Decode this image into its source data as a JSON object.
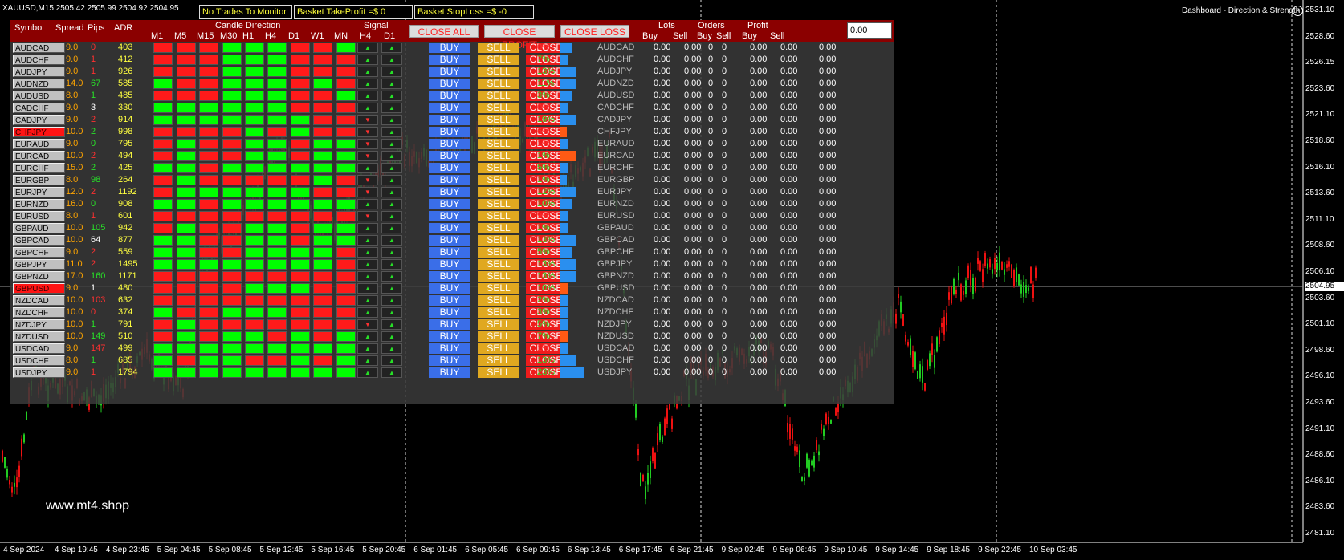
{
  "chart_window": {
    "title": "XAUUSD,M15  2505.42 2505.99 2504.92 2504.95",
    "watermark": "www.mt4.shop",
    "current_price": "2504.95",
    "price_axis": [
      "2531.10",
      "2528.60",
      "2526.15",
      "2523.60",
      "2521.10",
      "2518.60",
      "2516.10",
      "2513.60",
      "2511.10",
      "2508.60",
      "2506.10",
      "2503.60",
      "2501.10",
      "2498.60",
      "2496.10",
      "2493.60",
      "2491.10",
      "2488.60",
      "2486.10",
      "2483.60",
      "2481.10"
    ],
    "time_axis": [
      "4 Sep 2024",
      "4 Sep 19:45",
      "4 Sep 23:45",
      "5 Sep 04:45",
      "5 Sep 08:45",
      "5 Sep 12:45",
      "5 Sep 16:45",
      "5 Sep 20:45",
      "6 Sep 01:45",
      "6 Sep 05:45",
      "6 Sep 09:45",
      "6 Sep 13:45",
      "6 Sep 17:45",
      "6 Sep 21:45",
      "9 Sep 02:45",
      "9 Sep 06:45",
      "9 Sep 10:45",
      "9 Sep 14:45",
      "9 Sep 18:45",
      "9 Sep 22:45",
      "10 Sep 03:45"
    ],
    "close_icon": "close-icon",
    "up_color": "#22cc22",
    "down_color": "#ee1111"
  },
  "info_boxes": {
    "trades": "No Trades To Monitor",
    "tp": "Basket TakeProfit =$ 0",
    "sl": "Basket StopLoss =$ -0"
  },
  "dashboard": {
    "title": "Dashboard - Direction & Strength",
    "headers": {
      "symbol": "Symbol",
      "spread": "Spread",
      "pips": "Pips",
      "adr": "ADR",
      "candle_direction": "Candle Direction",
      "tfs": [
        "M1",
        "M5",
        "M15",
        "M30",
        "H1",
        "H4",
        "D1",
        "W1",
        "MN"
      ],
      "signal": "Signal",
      "signal_tfs": [
        "H4",
        "D1"
      ],
      "close_all": "CLOSE ALL",
      "close_profit": "CLOSE PROFIT",
      "close_loss": "CLOSE LOSS",
      "lots": "Lots",
      "orders": "Orders",
      "profit": "Profit",
      "buy": "Buy",
      "sell": "Sell",
      "amount": "0.00"
    },
    "button_labels": {
      "buy": "BUY",
      "sell": "SELL",
      "close": "CLOSE"
    },
    "zero": "0.00",
    "zero_int": "0",
    "total": "0.00",
    "rows": [
      {
        "symbol": "AUDCAD",
        "spread": "9.0",
        "pips": "0",
        "adr": "403",
        "dir": "RRRGGGRRG",
        "sig": [
          "▲",
          "▲"
        ],
        "pct": "0%",
        "strength": 14,
        "bc": "#2a8fef",
        "hl": false
      },
      {
        "symbol": "AUDCHF",
        "spread": "9.0",
        "pips": "1",
        "adr": "412",
        "dir": "RRRGGGRRR",
        "sig": [
          "▲",
          "▲"
        ],
        "pct": "7%",
        "strength": 10,
        "bc": "#2a8fef",
        "hl": false
      },
      {
        "symbol": "AUDJPY",
        "spread": "9.0",
        "pips": "1",
        "adr": "926",
        "dir": "RRRGGGRRR",
        "sig": [
          "▲",
          "▲"
        ],
        "pct": "13%",
        "strength": 19,
        "bc": "#2a8fef",
        "hl": false
      },
      {
        "symbol": "AUDNZD",
        "spread": "14.0",
        "pips": "67",
        "adr": "585",
        "dir": "GRRGGGRGR",
        "sig": [
          "▲",
          "▲"
        ],
        "pct": "11%",
        "strength": 19,
        "bc": "#2a8fef",
        "hl": false
      },
      {
        "symbol": "AUDUSD",
        "spread": "8.0",
        "pips": "1",
        "adr": "485",
        "dir": "RRRGGGRRG",
        "sig": [
          "▲",
          "▲"
        ],
        "pct": "3%",
        "strength": 14,
        "bc": "#2a8fef",
        "hl": false
      },
      {
        "symbol": "CADCHF",
        "spread": "9.0",
        "pips": "3",
        "adr": "330",
        "dir": "GGGGGGRRR",
        "sig": [
          "▲",
          "▲"
        ],
        "pct": "0%",
        "strength": 10,
        "bc": "#2a8fef",
        "hl": false
      },
      {
        "symbol": "CADJPY",
        "spread": "9.0",
        "pips": "2",
        "adr": "914",
        "dir": "GGGGGGGRR",
        "sig": [
          "▼",
          "▲"
        ],
        "pct": "19%",
        "strength": 19,
        "bc": "#2a8fef",
        "hl": false
      },
      {
        "symbol": "CHFJPY",
        "spread": "10.0",
        "pips": "2",
        "adr": "998",
        "dir": "RRRRGRGRR",
        "sig": [
          "▼",
          "▲"
        ],
        "pct": "6%",
        "strength": 8,
        "bc": "#ff5a14",
        "hl": true
      },
      {
        "symbol": "EURAUD",
        "spread": "9.0",
        "pips": "0",
        "adr": "795",
        "dir": "RGRRGGRGG",
        "sig": [
          "▼",
          "▲"
        ],
        "pct": "1%",
        "strength": 10,
        "bc": "#2a8fef",
        "hl": false
      },
      {
        "symbol": "EURCAD",
        "spread": "10.0",
        "pips": "2",
        "adr": "494",
        "dir": "RGRRGGRGG",
        "sig": [
          "▼",
          "▲"
        ],
        "pct": "1%",
        "strength": 19,
        "bc": "#ff5a14",
        "hl": false
      },
      {
        "symbol": "EURCHF",
        "spread": "15.0",
        "pips": "2",
        "adr": "425",
        "dir": "GGRGGGGGG",
        "sig": [
          "▲",
          "▲"
        ],
        "pct": "5%",
        "strength": 10,
        "bc": "#2a8fef",
        "hl": false
      },
      {
        "symbol": "EURGBP",
        "spread": "8.0",
        "pips": "98",
        "adr": "264",
        "dir": "RGRRRRRGR",
        "sig": [
          "▼",
          "▲"
        ],
        "pct": "1%",
        "strength": 8,
        "bc": "#2a8fef",
        "hl": false
      },
      {
        "symbol": "EURJPY",
        "spread": "12.0",
        "pips": "2",
        "adr": "1192",
        "dir": "RGGGGGGRR",
        "sig": [
          "▼",
          "▲"
        ],
        "pct": "12%",
        "strength": 19,
        "bc": "#2a8fef",
        "hl": false
      },
      {
        "symbol": "EURNZD",
        "spread": "16.0",
        "pips": "0",
        "adr": "908",
        "dir": "GGRGGGGGG",
        "sig": [
          "▲",
          "▲"
        ],
        "pct": "10%",
        "strength": 14,
        "bc": "#2a8fef",
        "hl": false
      },
      {
        "symbol": "EURUSD",
        "spread": "8.0",
        "pips": "1",
        "adr": "601",
        "dir": "RRRRRRRRR",
        "sig": [
          "▼",
          "▲"
        ],
        "pct": "9%",
        "strength": 10,
        "bc": "#2a8fef",
        "hl": false
      },
      {
        "symbol": "GBPAUD",
        "spread": "10.0",
        "pips": "105",
        "adr": "942",
        "dir": "RGRRGGRGG",
        "sig": [
          "▲",
          "▲"
        ],
        "pct": "1%",
        "strength": 10,
        "bc": "#2a8fef",
        "hl": false
      },
      {
        "symbol": "GBPCAD",
        "spread": "10.0",
        "pips": "64",
        "adr": "877",
        "dir": "GGRRGGRGG",
        "sig": [
          "▲",
          "▲"
        ],
        "pct": "13%",
        "strength": 19,
        "bc": "#2a8fef",
        "hl": false
      },
      {
        "symbol": "GBPCHF",
        "spread": "9.0",
        "pips": "2",
        "adr": "559",
        "dir": "GGRRGGGGR",
        "sig": [
          "▲",
          "▲"
        ],
        "pct": "5%",
        "strength": 14,
        "bc": "#2a8fef",
        "hl": false
      },
      {
        "symbol": "GBPJPY",
        "spread": "11.0",
        "pips": "2",
        "adr": "1495",
        "dir": "GGGGGGGGR",
        "sig": [
          "▲",
          "▲"
        ],
        "pct": "13%",
        "strength": 19,
        "bc": "#2a8fef",
        "hl": false
      },
      {
        "symbol": "GBPNZD",
        "spread": "17.0",
        "pips": "160",
        "adr": "1171",
        "dir": "RRRRRRRRR",
        "sig": [
          "▲",
          "▲"
        ],
        "pct": "13%",
        "strength": 19,
        "bc": "#2a8fef",
        "hl": false
      },
      {
        "symbol": "GBPUSD",
        "spread": "9.0",
        "pips": "1",
        "adr": "480",
        "dir": "RRRRGGGRR",
        "sig": [
          "▲",
          "▲"
        ],
        "pct": "10%",
        "strength": 10,
        "bc": "#ff5a14",
        "hl": true
      },
      {
        "symbol": "NZDCAD",
        "spread": "10.0",
        "pips": "103",
        "adr": "632",
        "dir": "RRRRRRRRR",
        "sig": [
          "▲",
          "▲"
        ],
        "pct": "2%",
        "strength": 10,
        "bc": "#2a8fef",
        "hl": false
      },
      {
        "symbol": "NZDCHF",
        "spread": "10.0",
        "pips": "0",
        "adr": "374",
        "dir": "GRRGGGRRR",
        "sig": [
          "▲",
          "▲"
        ],
        "pct": "3%",
        "strength": 10,
        "bc": "#2a8fef",
        "hl": false
      },
      {
        "symbol": "NZDJPY",
        "spread": "10.0",
        "pips": "1",
        "adr": "791",
        "dir": "RGRRRRRRR",
        "sig": [
          "▼",
          "▲"
        ],
        "pct": "5%",
        "strength": 10,
        "bc": "#2a8fef",
        "hl": false
      },
      {
        "symbol": "NZDUSD",
        "spread": "10.0",
        "pips": "149",
        "adr": "510",
        "dir": "RGRGGRGRG",
        "sig": [
          "▲",
          "▲"
        ],
        "pct": "7%",
        "strength": 10,
        "bc": "#ff5a14",
        "hl": false
      },
      {
        "symbol": "USDCAD",
        "spread": "9.0",
        "pips": "147",
        "adr": "499",
        "dir": "GGGGGGGGG",
        "sig": [
          "▲",
          "▲"
        ],
        "pct": "1%",
        "strength": 10,
        "bc": "#2a8fef",
        "hl": false
      },
      {
        "symbol": "USDCHF",
        "spread": "8.0",
        "pips": "1",
        "adr": "685",
        "dir": "GRGGRRGRG",
        "sig": [
          "▲",
          "▲"
        ],
        "pct": "13%",
        "strength": 19,
        "bc": "#2a8fef",
        "hl": false
      },
      {
        "symbol": "USDJPY",
        "spread": "9.0",
        "pips": "1",
        "adr": "1794",
        "dir": "GGGGGGGGG",
        "sig": [
          "▲",
          "▲"
        ],
        "pct": "23%",
        "strength": 29,
        "bc": "#2a8fef",
        "hl": false
      }
    ]
  }
}
